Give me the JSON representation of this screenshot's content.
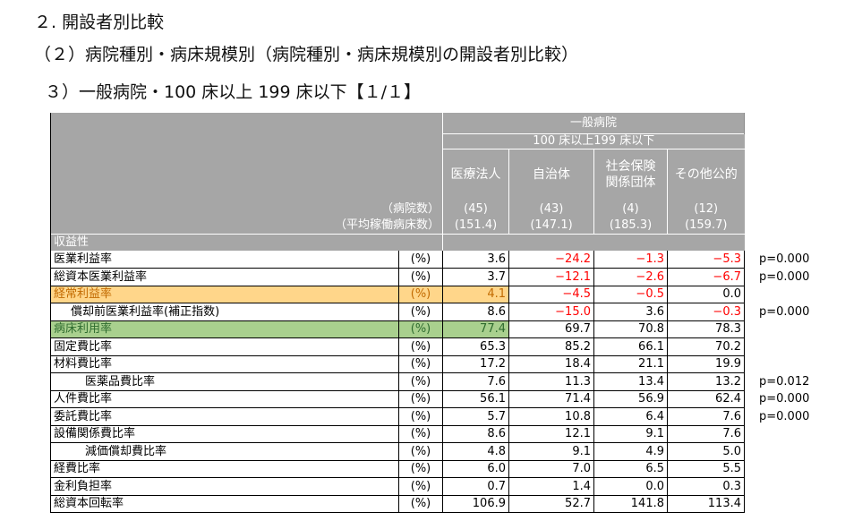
{
  "headings": {
    "h1": "２. 開設者別比較",
    "h2": "（２）病院種別・病床規模別（病院種別・病床規模別の開設者別比較）",
    "h3": "３）一般病院・100 床以上 199 床以下【１/１】"
  },
  "table": {
    "group_title": "一般病院",
    "group_subtitle": "100 床以上199 床以下",
    "columns": [
      "医療法人",
      "自治体",
      "社会保険\n関係団体",
      "その他公的"
    ],
    "hospital_count_label": "（病院数）",
    "hospital_counts": [
      "(45)",
      "(43)",
      "(4)",
      "(12)"
    ],
    "avg_beds_label": "（平均稼働病床数）",
    "avg_beds": [
      "(151.4)",
      "(147.1)",
      "(185.3)",
      "(159.7)"
    ],
    "section_label": "収益性",
    "rows": [
      {
        "label": "医業利益率",
        "unit": "(%)",
        "values": [
          "3.6",
          "−24.2",
          "−1.3",
          "−5.3"
        ],
        "neg": [
          false,
          true,
          true,
          true
        ],
        "p": "p=0.000",
        "indent": 0,
        "hl": ""
      },
      {
        "label": "総資本医業利益率",
        "unit": "(%)",
        "values": [
          "3.7",
          "−12.1",
          "−2.6",
          "−6.7"
        ],
        "neg": [
          false,
          true,
          true,
          true
        ],
        "p": "p=0.000",
        "indent": 0,
        "hl": ""
      },
      {
        "label": "経常利益率",
        "unit": "(%)",
        "values": [
          "4.1",
          "−4.5",
          "−0.5",
          "0.0"
        ],
        "neg": [
          false,
          true,
          true,
          false
        ],
        "p": "",
        "indent": 0,
        "hl": "orange"
      },
      {
        "label": "償却前医業利益率(補正指数)",
        "unit": "(%)",
        "values": [
          "8.6",
          "−15.0",
          "3.6",
          "−0.3"
        ],
        "neg": [
          false,
          true,
          false,
          true
        ],
        "p": "p=0.000",
        "indent": 1,
        "hl": ""
      },
      {
        "label": "病床利用率",
        "unit": "(%)",
        "values": [
          "77.4",
          "69.7",
          "70.8",
          "78.3"
        ],
        "neg": [
          false,
          false,
          false,
          false
        ],
        "p": "",
        "indent": 0,
        "hl": "green"
      },
      {
        "label": "固定費比率",
        "unit": "(%)",
        "values": [
          "65.3",
          "85.2",
          "66.1",
          "70.2"
        ],
        "neg": [
          false,
          false,
          false,
          false
        ],
        "p": "",
        "indent": 0,
        "hl": ""
      },
      {
        "label": "材料費比率",
        "unit": "(%)",
        "values": [
          "17.2",
          "18.4",
          "21.1",
          "19.9"
        ],
        "neg": [
          false,
          false,
          false,
          false
        ],
        "p": "",
        "indent": 0,
        "hl": ""
      },
      {
        "label": "医薬品費比率",
        "unit": "(%)",
        "values": [
          "7.6",
          "11.3",
          "13.4",
          "13.2"
        ],
        "neg": [
          false,
          false,
          false,
          false
        ],
        "p": "p=0.012",
        "indent": 2,
        "hl": ""
      },
      {
        "label": "人件費比率",
        "unit": "(%)",
        "values": [
          "56.1",
          "71.4",
          "56.9",
          "62.4"
        ],
        "neg": [
          false,
          false,
          false,
          false
        ],
        "p": "p=0.000",
        "indent": 0,
        "hl": ""
      },
      {
        "label": "委託費比率",
        "unit": "(%)",
        "values": [
          "5.7",
          "10.8",
          "6.4",
          "7.6"
        ],
        "neg": [
          false,
          false,
          false,
          false
        ],
        "p": "p=0.000",
        "indent": 0,
        "hl": ""
      },
      {
        "label": "設備関係費比率",
        "unit": "(%)",
        "values": [
          "8.6",
          "12.1",
          "9.1",
          "7.6"
        ],
        "neg": [
          false,
          false,
          false,
          false
        ],
        "p": "",
        "indent": 0,
        "hl": ""
      },
      {
        "label": "減価償却費比率",
        "unit": "(%)",
        "values": [
          "4.8",
          "9.1",
          "4.9",
          "5.0"
        ],
        "neg": [
          false,
          false,
          false,
          false
        ],
        "p": "",
        "indent": 2,
        "hl": ""
      },
      {
        "label": "経費比率",
        "unit": "(%)",
        "values": [
          "6.0",
          "7.0",
          "6.5",
          "5.5"
        ],
        "neg": [
          false,
          false,
          false,
          false
        ],
        "p": "",
        "indent": 0,
        "hl": ""
      },
      {
        "label": "金利負担率",
        "unit": "(%)",
        "values": [
          "0.7",
          "1.4",
          "0.0",
          "0.3"
        ],
        "neg": [
          false,
          false,
          false,
          false
        ],
        "p": "",
        "indent": 0,
        "hl": ""
      },
      {
        "label": "総資本回転率",
        "unit": "(%)",
        "values": [
          "106.9",
          "52.7",
          "141.8",
          "113.4"
        ],
        "neg": [
          false,
          false,
          false,
          false
        ],
        "p": "",
        "indent": 0,
        "hl": ""
      }
    ]
  }
}
